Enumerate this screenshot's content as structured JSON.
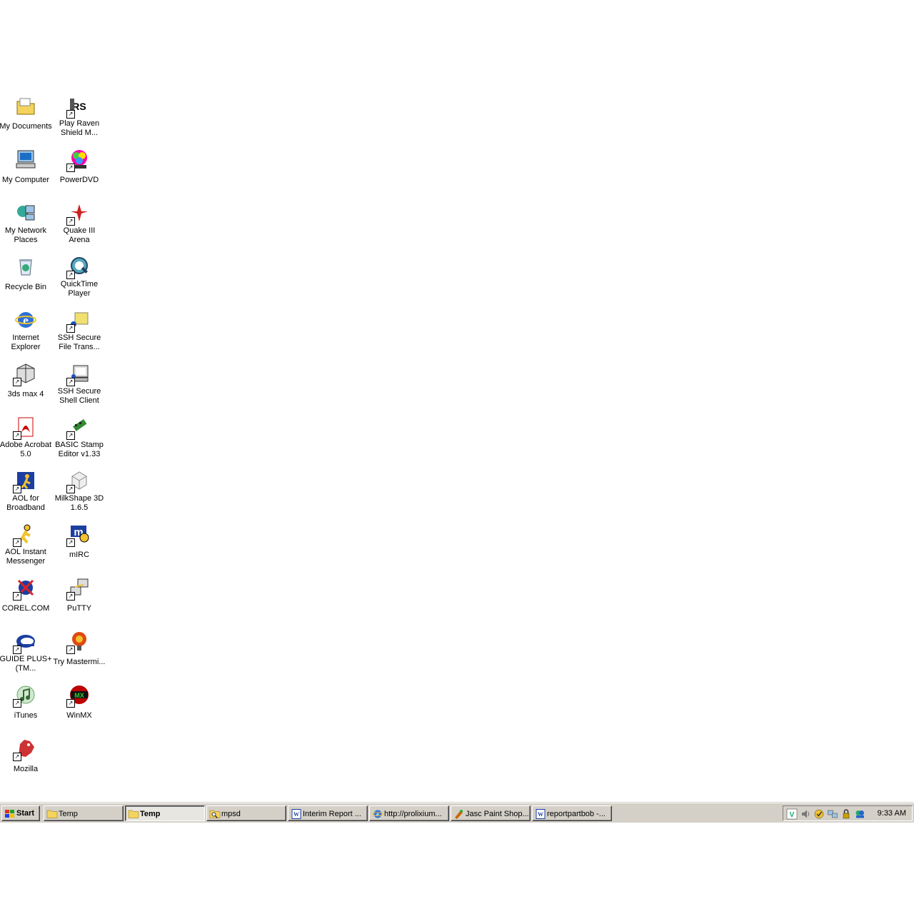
{
  "desktop": {
    "icons": [
      {
        "label": "My Documents",
        "icon": "my-documents-icon"
      },
      {
        "label": "Play Raven Shield M...",
        "icon": "raven-shield-icon"
      },
      {
        "label": "My Computer",
        "icon": "my-computer-icon"
      },
      {
        "label": "PowerDVD",
        "icon": "powerdvd-icon"
      },
      {
        "label": "My Network Places",
        "icon": "network-places-icon"
      },
      {
        "label": "Quake III Arena",
        "icon": "quake-icon"
      },
      {
        "label": "Recycle Bin",
        "icon": "recycle-bin-icon"
      },
      {
        "label": "QuickTime Player",
        "icon": "quicktime-icon"
      },
      {
        "label": "Internet Explorer",
        "icon": "internet-explorer-icon"
      },
      {
        "label": "SSH Secure File Trans...",
        "icon": "ssh-file-transfer-icon"
      },
      {
        "label": "3ds max 4",
        "icon": "3ds-max-icon"
      },
      {
        "label": "SSH Secure Shell Client",
        "icon": "ssh-shell-client-icon"
      },
      {
        "label": "Adobe Acrobat 5.0",
        "icon": "acrobat-icon"
      },
      {
        "label": "BASIC Stamp Editor v1.33",
        "icon": "basic-stamp-icon"
      },
      {
        "label": "AOL for Broadband",
        "icon": "aol-broadband-icon"
      },
      {
        "label": "MilkShape 3D 1.6.5",
        "icon": "milkshape-icon"
      },
      {
        "label": "AOL Instant Messenger",
        "icon": "aim-icon"
      },
      {
        "label": "mIRC",
        "icon": "mirc-icon"
      },
      {
        "label": "COREL.COM",
        "icon": "corel-icon"
      },
      {
        "label": "PuTTY",
        "icon": "putty-icon"
      },
      {
        "label": "GUIDE PLUS+(TM...",
        "icon": "guide-plus-icon"
      },
      {
        "label": "Try Mastermi...",
        "icon": "mastermind-icon"
      },
      {
        "label": "iTunes",
        "icon": "itunes-icon"
      },
      {
        "label": "WinMX",
        "icon": "winmx-icon"
      },
      {
        "label": "Mozilla",
        "icon": "mozilla-icon"
      }
    ]
  },
  "taskbar": {
    "start_label": "Start",
    "buttons": [
      {
        "label": "Temp",
        "icon": "folder-icon",
        "active": false
      },
      {
        "label": "Temp",
        "icon": "folder-icon",
        "active": true
      },
      {
        "label": "mpsd",
        "icon": "search-folder-icon",
        "active": false
      },
      {
        "label": "Interim Report ...",
        "icon": "word-doc-icon",
        "active": false
      },
      {
        "label": "http://prolixium...",
        "icon": "internet-explorer-icon",
        "active": false
      },
      {
        "label": "Jasc Paint Shop...",
        "icon": "paint-shop-icon",
        "active": false
      },
      {
        "label": "reportpartbob -...",
        "icon": "word-doc-icon",
        "active": false
      }
    ],
    "tray": {
      "icons": [
        "vnc-icon",
        "volume-icon",
        "norton-icon",
        "network-icon",
        "security-icon",
        "messenger-icon"
      ],
      "clock": "9:33 AM"
    }
  },
  "colors": {
    "desktop_background": "#ffffff",
    "taskbar": "#d4d0c8"
  }
}
